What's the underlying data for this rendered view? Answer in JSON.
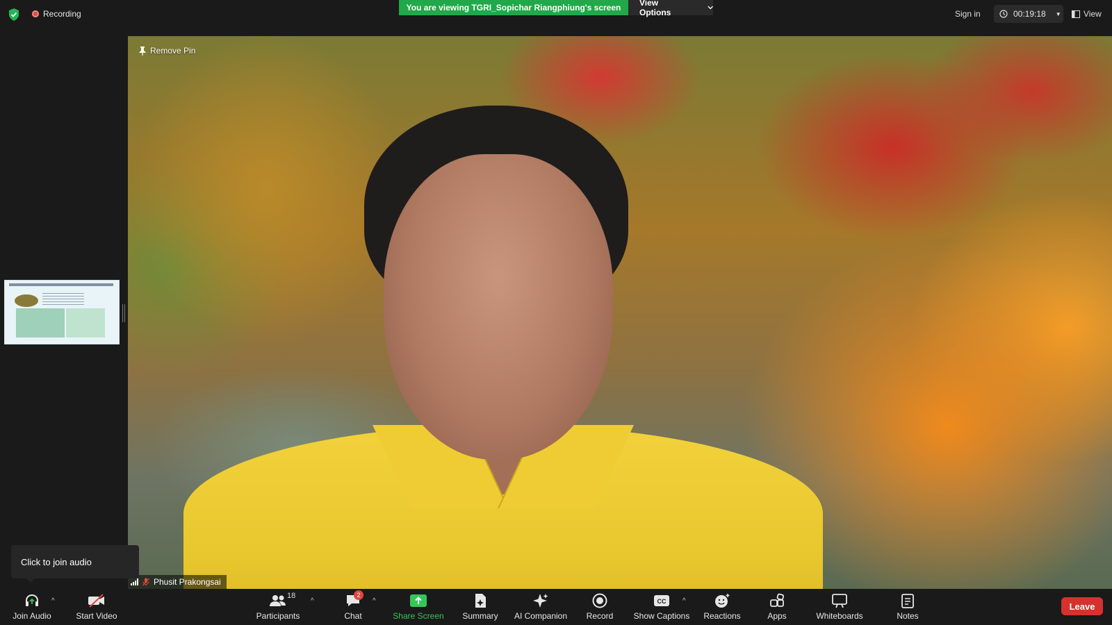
{
  "top": {
    "recording_label": "Recording",
    "banner_text": "You are viewing TGRI_Sopichar Riangphiung's screen",
    "view_options_label": "View Options",
    "sign_in_label": "Sign in",
    "timer": "00:19:18",
    "view_label": "View"
  },
  "stage": {
    "remove_pin_label": "Remove Pin",
    "participant_name": "Phusit Prakongsai"
  },
  "tooltip": {
    "text": "Click to join audio"
  },
  "toolbar": {
    "join_audio": "Join Audio",
    "start_video": "Start Video",
    "participants": "Participants",
    "participants_count": "18",
    "chat": "Chat",
    "chat_badge": "2",
    "share_screen": "Share Screen",
    "summary": "Summary",
    "ai_companion": "AI Companion",
    "record": "Record",
    "show_captions": "Show Captions",
    "reactions": "Reactions",
    "apps": "Apps",
    "whiteboards": "Whiteboards",
    "notes": "Notes",
    "leave": "Leave"
  },
  "colors": {
    "banner_green": "#21a84a",
    "share_green": "#34c759",
    "leave_red": "#d5322d",
    "background": "#1a1a1a"
  },
  "icons": [
    "shield-check-icon",
    "record-icon",
    "chevron-down-icon",
    "clock-icon",
    "view-icon",
    "pin-icon",
    "signal-icon",
    "mic-muted-icon",
    "headphones-icon",
    "video-off-icon",
    "participants-icon",
    "chat-icon",
    "share-screen-icon",
    "summary-icon",
    "ai-sparkle-icon",
    "record-circle-icon",
    "cc-icon",
    "reactions-icon",
    "apps-icon",
    "whiteboard-icon",
    "notes-icon"
  ]
}
